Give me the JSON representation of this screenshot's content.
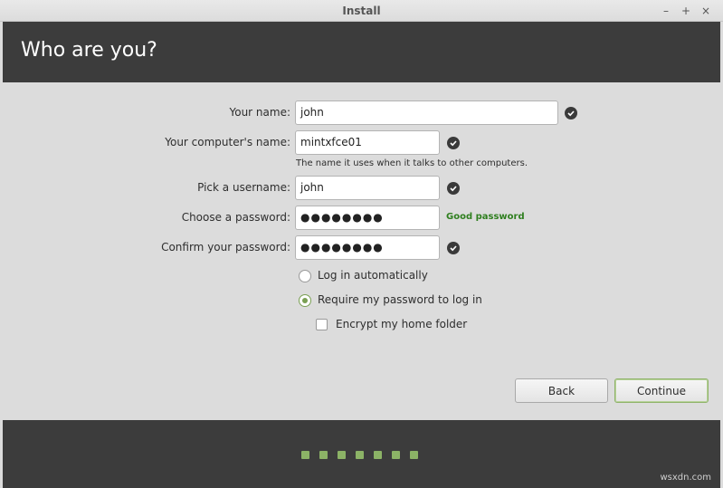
{
  "window": {
    "title": "Install",
    "minimize_glyph": "–",
    "maximize_glyph": "+",
    "close_glyph": "×"
  },
  "header": {
    "title": "Who are you?"
  },
  "form": {
    "name_label": "Your name:",
    "name_value": "john",
    "computer_label": "Your computer's name:",
    "computer_value": "mintxfce01",
    "computer_hint": "The name it uses when it talks to other computers.",
    "username_label": "Pick a username:",
    "username_value": "john",
    "password_label": "Choose a password:",
    "password_value": "●●●●●●●●",
    "password_strength": "Good password",
    "confirm_label": "Confirm your password:",
    "confirm_value": "●●●●●●●●",
    "login_auto_label": "Log in automatically",
    "login_password_label": "Require my password to log in",
    "encrypt_label": "Encrypt my home folder",
    "selected_login_option": "Require my password to log in",
    "encrypt_checked": false
  },
  "buttons": {
    "back": "Back",
    "continue": "Continue"
  },
  "progress": {
    "total_steps": 7
  },
  "watermark": "wsxdn.com",
  "colors": {
    "header_bg": "#3c3c3c",
    "accent": "#8cb366",
    "good_password": "#2f7f1f",
    "body_bg": "#dcdcdc"
  }
}
